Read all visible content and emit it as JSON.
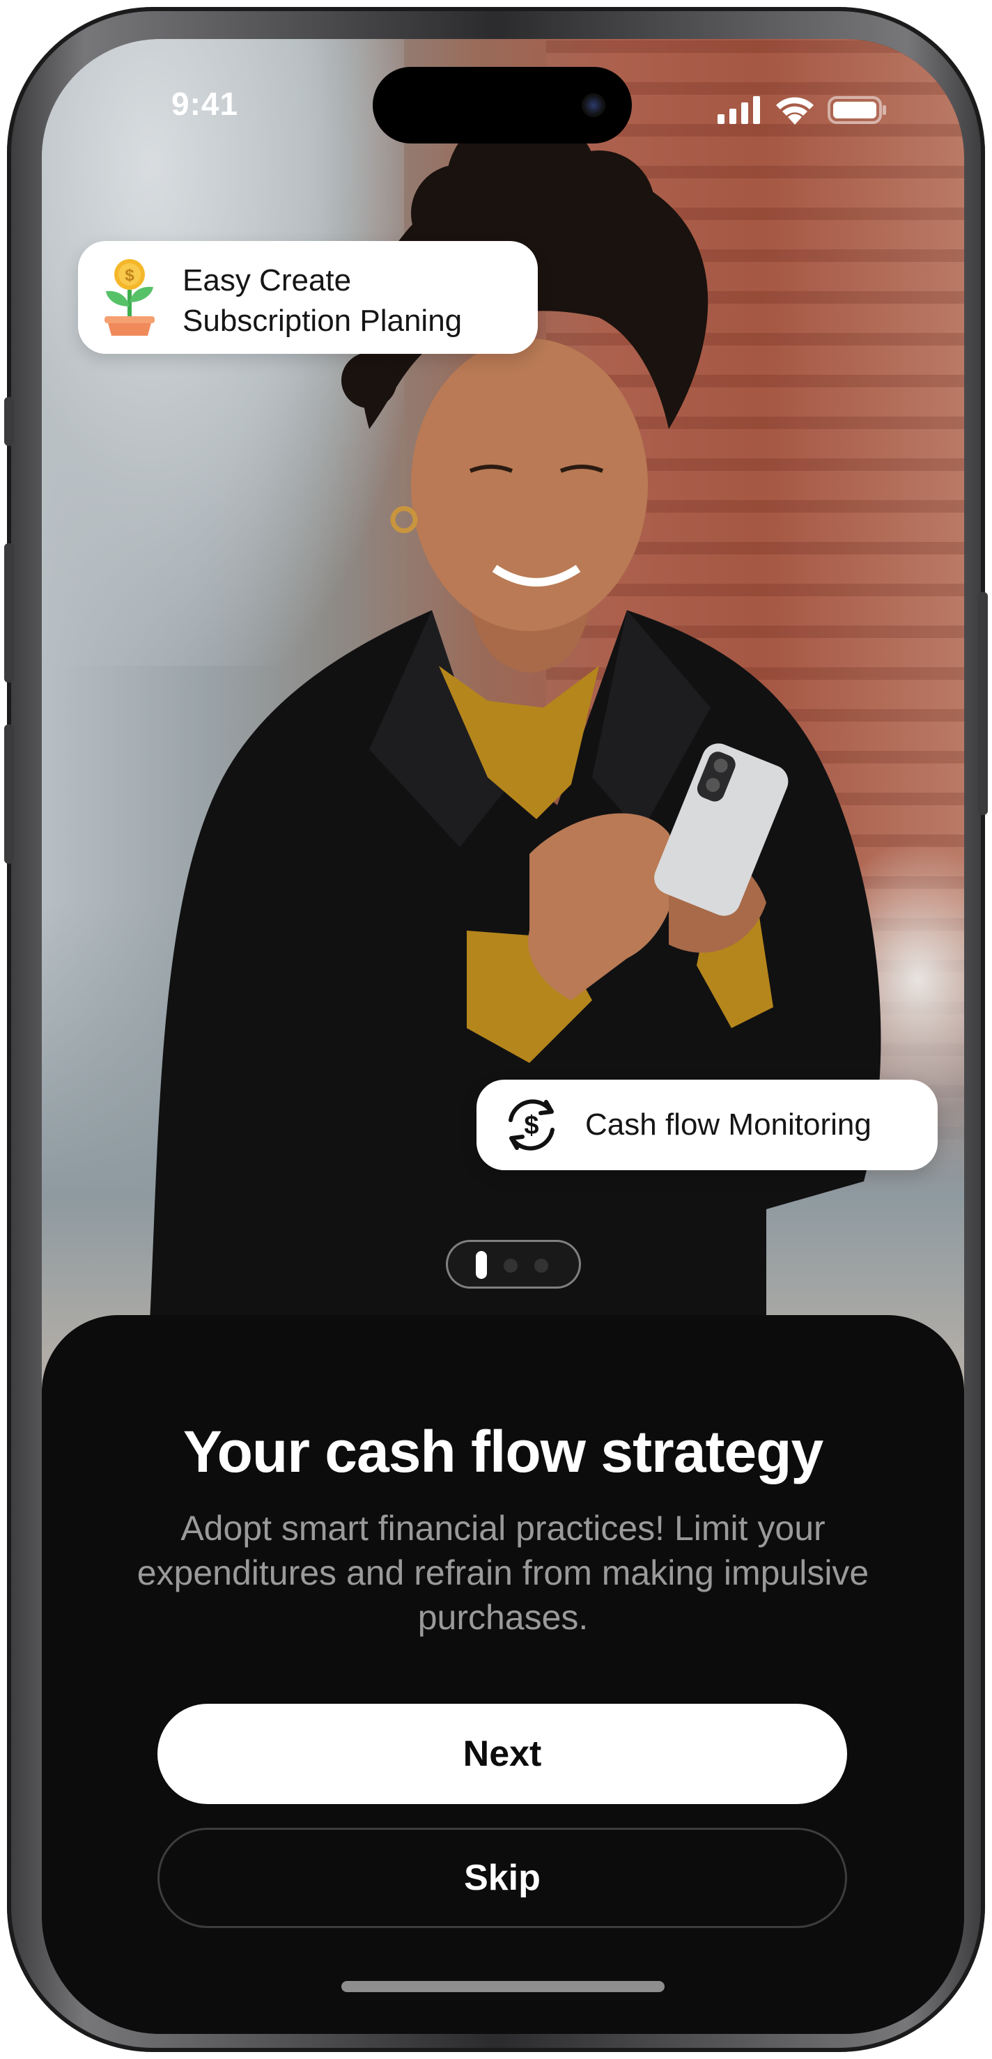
{
  "status_bar": {
    "time": "9:41",
    "icons": [
      "cellular-signal-icon",
      "wifi-icon",
      "battery-icon"
    ]
  },
  "cards": {
    "planning": {
      "icon": "money-plant-icon",
      "line1": "Easy Create",
      "line2": "Subscription Planing"
    },
    "monitoring": {
      "icon": "dollar-cycle-icon",
      "label": "Cash flow Monitoring"
    }
  },
  "pager": {
    "current_page": 1,
    "total_pages": 3
  },
  "onboarding": {
    "title": "Your cash flow strategy",
    "description": "Adopt smart financial practices!  Limit your expenditures and refrain from making impulsive purchases.",
    "next_label": "Next",
    "skip_label": "Skip"
  },
  "colors": {
    "sheet_background": "#0c0c0c",
    "primary_button": "#ffffff",
    "text_primary": "#ffffff",
    "text_secondary": "#9a9a9a"
  }
}
